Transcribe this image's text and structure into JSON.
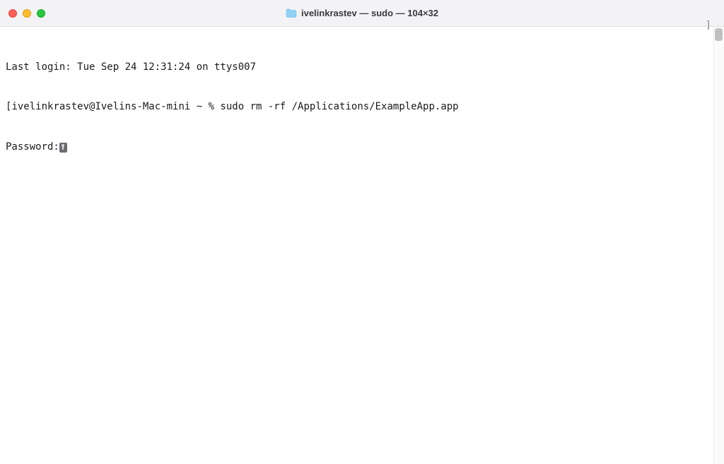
{
  "titlebar": {
    "title": "ivelinkrastev — sudo — 104×32"
  },
  "terminal": {
    "line1": "Last login: Tue Sep 24 12:31:24 on ttys007",
    "line2_bracket": "[",
    "line2_prompt": "ivelinkrastev@Ivelins-Mac-mini ~ % ",
    "line2_command": "sudo rm -rf /Applications/ExampleApp.app",
    "line3_label": "Password:",
    "right_bracket": "]"
  }
}
